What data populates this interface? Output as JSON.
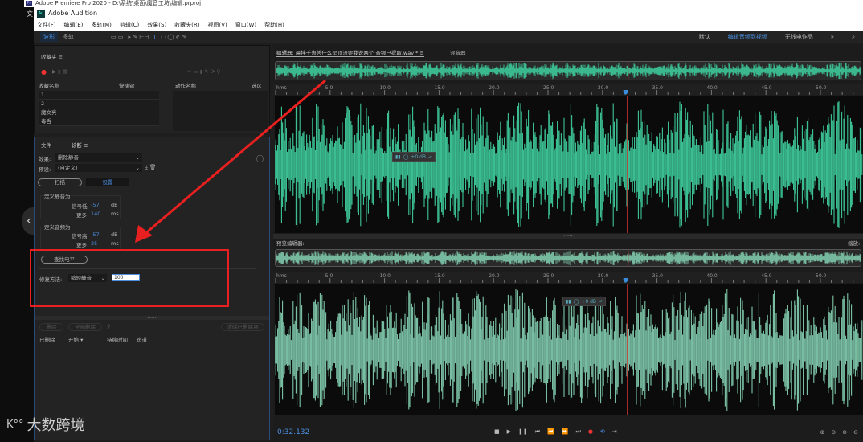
{
  "premiere": {
    "title": "Adobe Premiere Pro 2020 - D:\\系统\\桌面\\魔音工坊\\编辑.prproj",
    "icon": "Pr",
    "side_char": "文"
  },
  "audition": {
    "title": "Adobe Audition",
    "icon": "Au"
  },
  "menu": [
    "文件(F)",
    "编辑(E)",
    "多轨(M)",
    "剪辑(C)",
    "效果(S)",
    "收藏夹(R)",
    "视图(V)",
    "窗口(W)",
    "帮助(H)"
  ],
  "toolbar": {
    "waveform": "波形",
    "multitrack": "多轨"
  },
  "workspaces": {
    "default": "默认",
    "active": "编辑音频到视频",
    "radio": "无线电作品",
    "more": "»"
  },
  "favorites": {
    "title": "收藏夹",
    "col_name": "收藏名称",
    "col_shortcut": "快捷键",
    "col_action": "动作名称",
    "col_selection": "选区",
    "items": [
      "1",
      "2",
      "魔文亮",
      "毒舌"
    ]
  },
  "diagnostics": {
    "tab_file": "文件",
    "tab_diag": "诊断",
    "effect_label": "效果:",
    "effect_value": "删除静音",
    "preset_label": "预设:",
    "preset_value": "(自定义)",
    "scan": "扫描",
    "settings": "设置",
    "silence_title": "定义静音为",
    "signal_low": "信号低",
    "signal_low_val": "-57",
    "db": "dB",
    "more": "更多",
    "silence_ms": "140",
    "ms": "ms",
    "audio_title": "定义音频为",
    "signal_high": "信号高",
    "signal_high_val": "-57",
    "audio_ms": "25",
    "find_level": "查找电平",
    "repair_label": "修复方法:",
    "repair_value": "缩短静音",
    "repair_input": "100",
    "delete": "删除",
    "delete_all": "全部删除",
    "clear_deleted": "清除已删除项",
    "col_deleted": "已删除",
    "col_start": "开始 ▾",
    "col_duration": "持续时间",
    "col_channel": "声道"
  },
  "editor": {
    "tab": "编辑器: 晨拌千蛊凭什么是顶流要我说两个 音频已提取.wav *",
    "mixer": "混音器",
    "preview_label": "预览编辑器:",
    "zoom_label": "缩放:",
    "hud_db": "+0 dB",
    "ruler_unit": "hms",
    "ticks": [
      "5.0",
      "10.0",
      "15.0",
      "20.0",
      "25.0",
      "30.0",
      "35.0",
      "40.0",
      "45.0",
      "50.0"
    ],
    "playhead_s": 32.132,
    "wave_color": "#3ec99a",
    "preview_wave_color": "#7fc9ac"
  },
  "transport": {
    "time": "0:32.132"
  },
  "annotation_color": "#e82020",
  "watermark": "大数跨境"
}
